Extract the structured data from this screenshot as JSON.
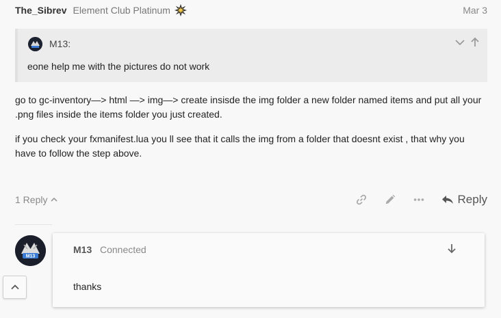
{
  "post": {
    "username": "The_Sibrev",
    "user_title": "Element Club Platinum",
    "date": "Mar 3",
    "quote": {
      "author": "M13:",
      "text": "eone help me with the pictures do not work"
    },
    "body": [
      "go to gc-inventory—> html —> img—> create insisde the img folder a new folder named items and put all your .png files inside the items folder you just created.",
      "if you check your fxmanifest.lua you ll see that it calls the img from a folder that doesnt exist , that why you have to follow the step above."
    ],
    "replies_label": "1 Reply",
    "reply_label": "Reply"
  },
  "reply": {
    "author": "M13",
    "status": "Connected",
    "text": "thanks",
    "avatar_text": "M13"
  },
  "icons": {
    "badge": "starburst-badge-icon",
    "link": "link-icon",
    "edit": "pencil-icon",
    "more": "ellipsis-icon",
    "reply": "reply-arrow-icon",
    "scroll_top": "chevron-up-icon"
  },
  "colors": {
    "background": "#f8f8f8",
    "quote_bg": "#ececec",
    "muted_text": "#888888"
  }
}
